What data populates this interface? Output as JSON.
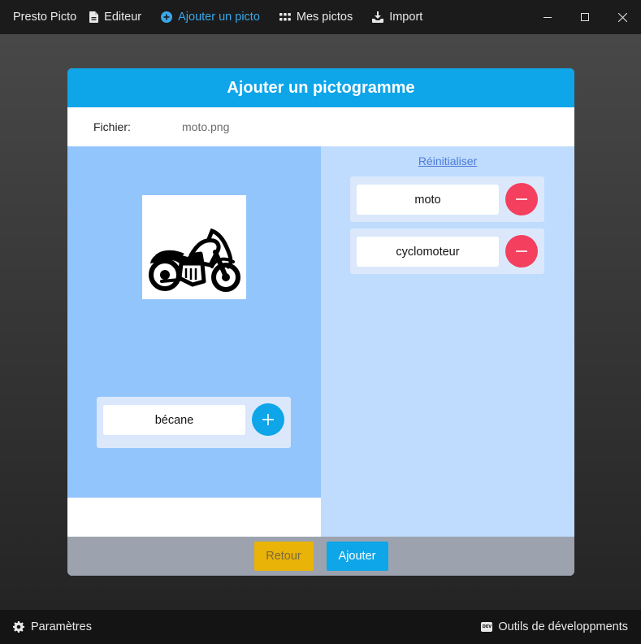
{
  "app": {
    "name": "Presto Picto",
    "nav": [
      {
        "label": "Editeur",
        "icon": "file-icon"
      },
      {
        "label": "Ajouter un picto",
        "icon": "plus-circle-icon",
        "active": true
      },
      {
        "label": "Mes pictos",
        "icon": "grid-icon"
      },
      {
        "label": "Import",
        "icon": "download-icon"
      }
    ]
  },
  "modal": {
    "title": "Ajouter un pictogramme",
    "file_label": "Fichier:",
    "file_value": "moto.png",
    "picto_icon": "motorcycle-icon",
    "new_keyword_value": "bécane",
    "reset_label": "Réinitialiser",
    "keywords": [
      "moto",
      "cyclomoteur"
    ],
    "back_label": "Retour",
    "add_label": "Ajouter"
  },
  "statusbar": {
    "settings_label": "Paramètres",
    "devtools_label": "Outils de développments",
    "devtools_badge": "DEV"
  },
  "colors": {
    "accent": "#0ea5e9",
    "danger": "#f43f5e",
    "warning": "#eab308",
    "panel_left": "#93c5fd",
    "panel_right": "#bfdbfe"
  }
}
